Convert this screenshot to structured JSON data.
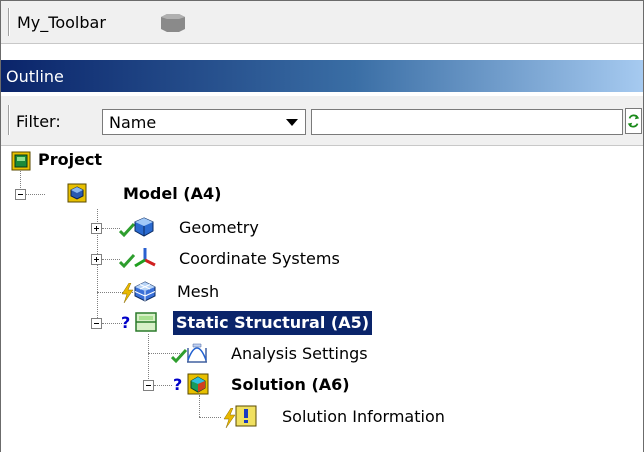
{
  "toolbar": {
    "label": "My_Toolbar",
    "icon": "toolbar-shape-icon"
  },
  "panel": {
    "title": "Outline"
  },
  "filter": {
    "label": "Filter:",
    "selected": "Name",
    "search_value": "",
    "refresh_icon": "refresh-icon"
  },
  "tree": {
    "project": {
      "label": "Project",
      "icon": "project-icon"
    },
    "model": {
      "label": "Model (A4)",
      "icon": "model-cube-icon",
      "expanded": true
    },
    "geometry": {
      "label": "Geometry",
      "icon": "geometry-icon",
      "status": "check",
      "expanded": false
    },
    "coordinate_systems": {
      "label": "Coordinate Systems",
      "icon": "axes-icon",
      "status": "check",
      "expanded": false
    },
    "mesh": {
      "label": "Mesh",
      "icon": "mesh-icon",
      "status": "lightning"
    },
    "static_structural": {
      "label": "Static Structural (A5)",
      "icon": "static-structural-icon",
      "status": "question",
      "expanded": true,
      "selected": true
    },
    "analysis_settings": {
      "label": "Analysis Settings",
      "icon": "analysis-settings-icon",
      "status": "check"
    },
    "solution": {
      "label": "Solution (A6)",
      "icon": "solution-icon",
      "status": "question",
      "expanded": true
    },
    "solution_information": {
      "label": "Solution Information",
      "icon": "info-icon",
      "status": "lightning"
    }
  },
  "colors": {
    "header_dark": "#0a246a",
    "header_light": "#a6caf0",
    "selection": "#0a246a",
    "check": "#2e9e2e",
    "question": "#0000c8",
    "lightning": "#e8b800"
  }
}
